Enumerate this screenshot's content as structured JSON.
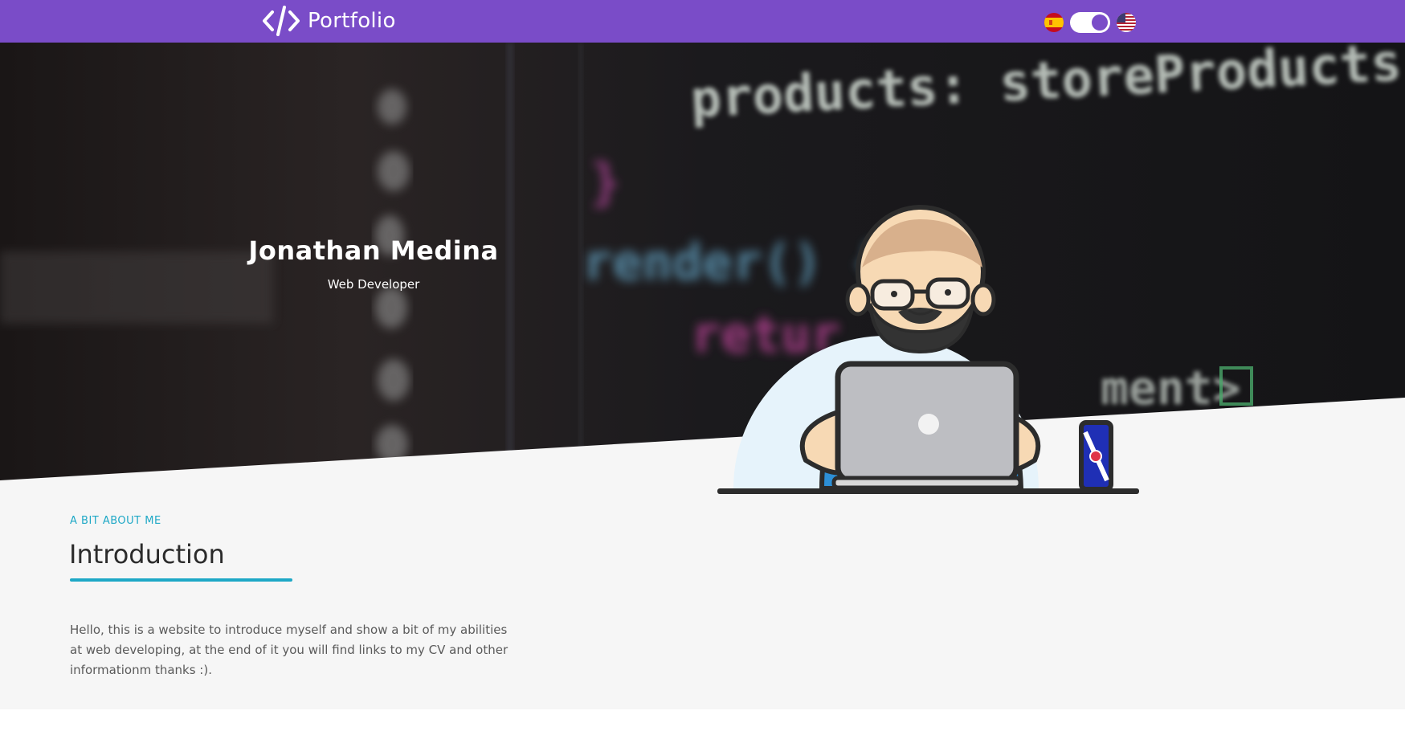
{
  "navbar": {
    "brand_name": "Portfolio",
    "brand_icon": "code-icon",
    "bg_color": "#7a4cc8",
    "language": {
      "options": [
        "es",
        "en"
      ],
      "toggle_on": true
    }
  },
  "hero": {
    "name": "Jonathan Medina",
    "role": "Web Developer",
    "background_code_text": [
      "products: storeProducts",
      "render() {",
      "retur",
      "ment>"
    ]
  },
  "about": {
    "eyebrow": "A BIT ABOUT ME",
    "title": "Introduction",
    "text": "Hello, this is a website to introduce myself and show a bit of my abilities at web developing, at the end of it you will find links to my CV and other informationm thanks :).",
    "accent_color": "#1ea8c6"
  }
}
